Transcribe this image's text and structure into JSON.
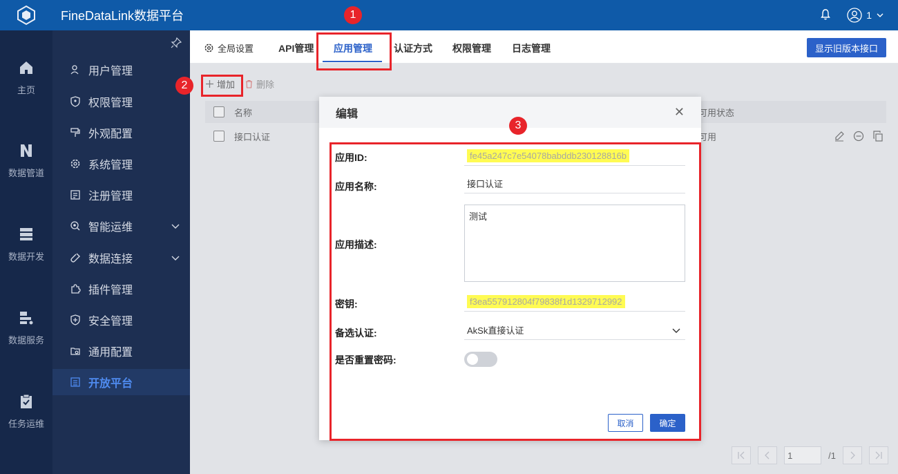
{
  "app": {
    "title": "FineDataLink数据平台",
    "user_count": "1"
  },
  "rail": [
    {
      "label": "主页",
      "icon": "home-icon"
    },
    {
      "label": "数据管道",
      "icon": "pipeline-icon"
    },
    {
      "label": "数据开发",
      "icon": "dev-icon"
    },
    {
      "label": "数据服务",
      "icon": "service-icon"
    },
    {
      "label": "任务运维",
      "icon": "task-icon"
    }
  ],
  "submenu": [
    {
      "label": "用户管理",
      "icon": "user-icon"
    },
    {
      "label": "权限管理",
      "icon": "permission-icon"
    },
    {
      "label": "外观配置",
      "icon": "appearance-icon"
    },
    {
      "label": "系统管理",
      "icon": "system-icon"
    },
    {
      "label": "注册管理",
      "icon": "register-icon"
    },
    {
      "label": "智能运维",
      "icon": "ops-icon"
    },
    {
      "label": "数据连接",
      "icon": "connection-icon"
    },
    {
      "label": "插件管理",
      "icon": "plugin-icon"
    },
    {
      "label": "安全管理",
      "icon": "security-icon"
    },
    {
      "label": "通用配置",
      "icon": "config-icon"
    },
    {
      "label": "开放平台",
      "icon": "platform-icon"
    }
  ],
  "tabs": {
    "global": "全局设置",
    "api": "API管理",
    "app": "应用管理",
    "auth": "认证方式",
    "perm": "权限管理",
    "log": "日志管理",
    "old_btn": "显示旧版本接口"
  },
  "toolbar": {
    "add": "增加",
    "delete": "删除"
  },
  "table": {
    "col_name": "名称",
    "col_status": "可用状态",
    "rows": [
      {
        "name": "接口认证",
        "status": "可用"
      }
    ]
  },
  "pager": {
    "page": "1",
    "total": "/1"
  },
  "dialog": {
    "title": "编辑",
    "app_id_label": "应用ID:",
    "app_id": "fe45a247c7e54078babddb230128816b",
    "app_name_label": "应用名称:",
    "app_name": "接口认证",
    "app_desc_label": "应用描述:",
    "app_desc": "测试",
    "secret_label": "密钥:",
    "secret": "f3ea557912804f79838f1d1329712992",
    "auth_label": "备选认证:",
    "auth_value": "AkSk直接认证",
    "reset_label": "是否重置密码:",
    "reset_on": false,
    "cancel": "取消",
    "ok": "确定"
  },
  "markers": {
    "m1": "1",
    "m2": "2",
    "m3": "3"
  }
}
